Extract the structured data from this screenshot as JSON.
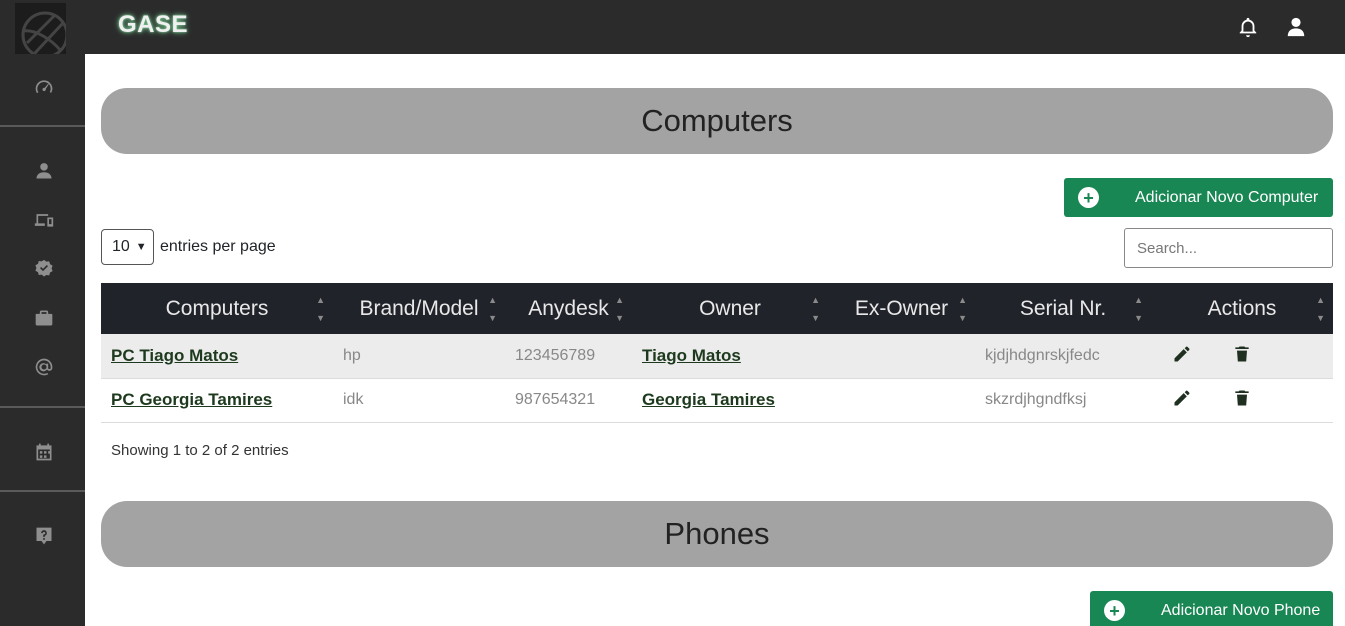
{
  "app": {
    "brand": "GASE"
  },
  "sidebar": {
    "items": [
      {
        "icon": "speedometer-icon"
      },
      {
        "icon": "user-icon"
      },
      {
        "icon": "devices-icon"
      },
      {
        "icon": "verified-badge-icon"
      },
      {
        "icon": "briefcase-icon"
      },
      {
        "icon": "at-sign-icon"
      },
      {
        "icon": "calendar-icon"
      },
      {
        "icon": "help-icon"
      }
    ]
  },
  "topbar": {
    "icons": [
      "bell-icon",
      "user-icon"
    ]
  },
  "computers": {
    "title": "Computers",
    "add_label": "Adicionar Novo Computer",
    "entries_select": "10",
    "entries_label": "entries per page",
    "search_placeholder": "Search...",
    "columns": [
      "Computers",
      "Brand/Model",
      "Anydesk",
      "Owner",
      "Ex-Owner",
      "Serial Nr.",
      "Actions"
    ],
    "rows": [
      {
        "name": "PC Tiago Matos",
        "brand": "hp",
        "anydesk": "123456789",
        "owner": "Tiago Matos",
        "ex_owner": "",
        "serial": "kjdjhdgnrskjfedc"
      },
      {
        "name": "PC Georgia Tamires",
        "brand": "idk",
        "anydesk": "987654321",
        "owner": "Georgia Tamires",
        "ex_owner": "",
        "serial": "skzrdjhgndfksj"
      }
    ],
    "showing": "Showing 1 to 2 of 2 entries"
  },
  "phones": {
    "title": "Phones",
    "add_label": "Adicionar Novo Phone"
  },
  "colors": {
    "accent": "#198754",
    "sidebar": "#2b2b2b",
    "table_header": "#20232a",
    "banner": "#a3a3a3"
  }
}
